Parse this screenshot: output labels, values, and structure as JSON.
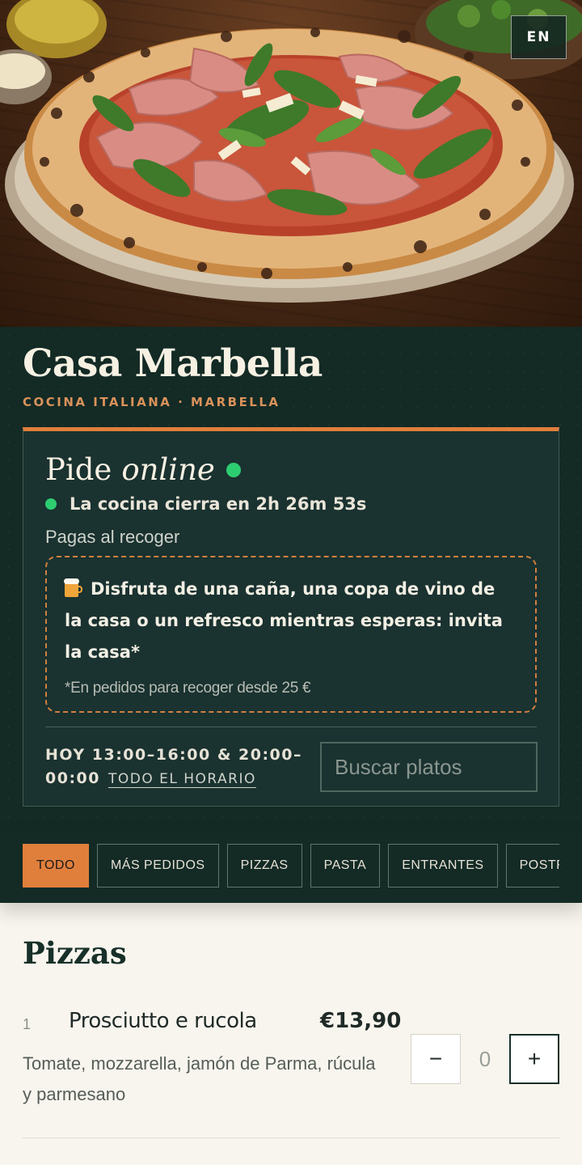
{
  "header": {
    "language_button": "EN",
    "restaurant_name": "Casa Marbella",
    "subtitle": "COCINA ITALIANA · MARBELLA"
  },
  "order_card": {
    "title_prefix": "Pide",
    "title_emphasis": "online",
    "status_color": "#2ecc71",
    "closing_text": "La cocina cierra en 2h 26m 53s",
    "payment_note": "Pagas al recoger",
    "promo": {
      "icon": "beer-icon",
      "text": "Disfruta de una caña, una copa de vino de la casa o un refresco mientras esperas: invita la casa*",
      "footnote": "*En pedidos para recoger desde 25 €"
    },
    "hours": "HOY 13:00–16:00 & 20:00–00:00",
    "hours_link": "TODO EL HORARIO",
    "search_placeholder": "Buscar platos"
  },
  "categories": [
    {
      "label": "TODO",
      "active": true
    },
    {
      "label": "MÁS PEDIDOS",
      "active": false
    },
    {
      "label": "PIZZAS",
      "active": false
    },
    {
      "label": "PASTA",
      "active": false
    },
    {
      "label": "ENTRANTES",
      "active": false
    },
    {
      "label": "POSTRES",
      "active": false
    }
  ],
  "menu": {
    "section_title": "Pizzas",
    "items": [
      {
        "number": "1",
        "name": "Prosciutto e rucola",
        "price": "€13,90",
        "description": "Tomate, mozzarella, jamón de Parma, rúcula y parmesano",
        "quantity": "0",
        "minus_label": "−",
        "plus_label": "+"
      }
    ]
  },
  "colors": {
    "accent": "#e07f3c",
    "dark_green": "#132a25",
    "cream": "#f8f5ee"
  }
}
